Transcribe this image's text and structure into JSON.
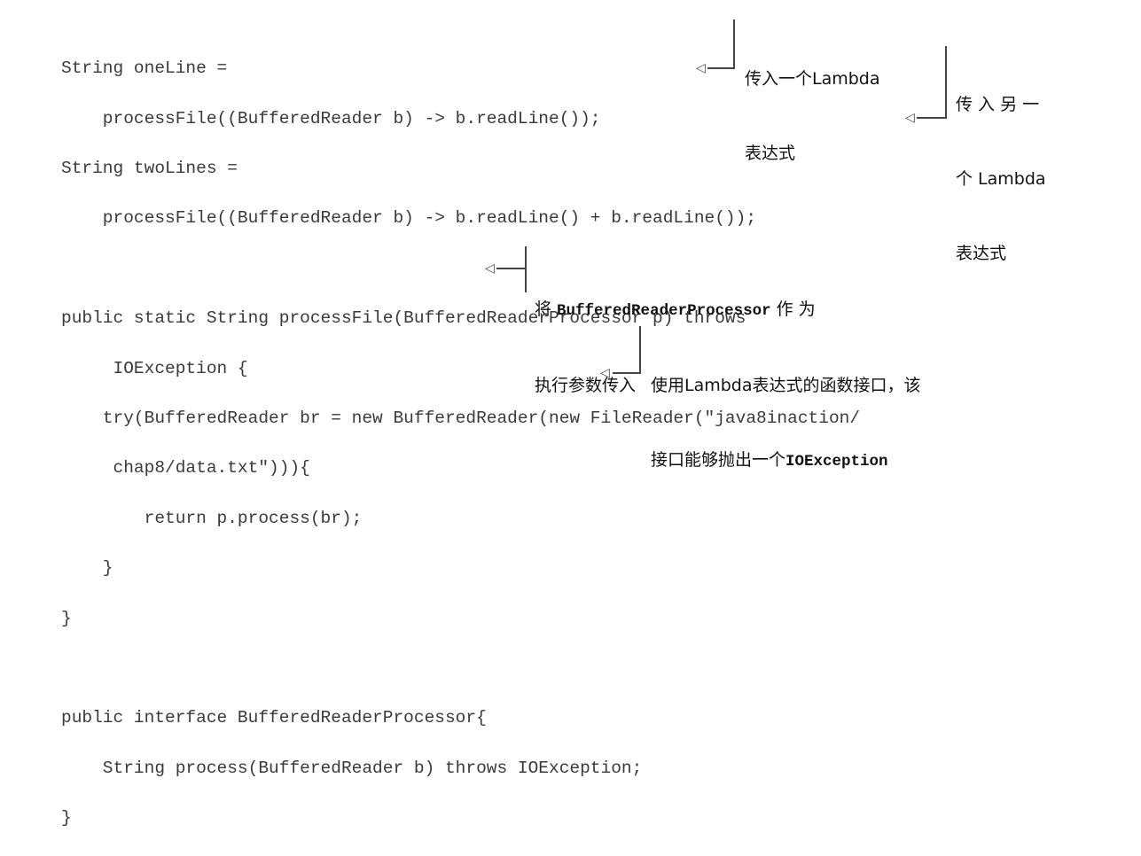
{
  "code": {
    "line1": "String oneLine =",
    "line2": "    processFile((BufferedReader b) -> b.readLine());",
    "line3": "String twoLines =",
    "line4": "    processFile((BufferedReader b) -> b.readLine() + b.readLine());",
    "line5": "",
    "line6": "public static String processFile(BufferedReaderProcessor p) throws",
    "line7": "     IOException {",
    "line8": "    try(BufferedReader br = new BufferedReader(new FileReader(\"java8inaction/",
    "line9": "     chap8/data.txt\"))){",
    "line10": "        return p.process(br);",
    "line11": "    }",
    "line12": "}",
    "line13": "",
    "line14": "public interface BufferedReaderProcessor{",
    "line15": "    String process(BufferedReader b) throws IOException;",
    "line16": "}"
  },
  "annotations": {
    "a1": {
      "line1": "传入一个Lambda",
      "line2": "表达式"
    },
    "a2": {
      "line1": "传 入 另 一",
      "line2": "个 Lambda",
      "line3": "表达式"
    },
    "a3": {
      "prefix": "将 ",
      "code": "BufferedReaderProcessor",
      "suffix": " 作 为",
      "line2": "执行参数传入"
    },
    "a4": {
      "line1": "使用Lambda表达式的函数接口，该",
      "line2_prefix": "接口能够抛出一个",
      "line2_code": "IOException"
    }
  },
  "colors": {
    "code_text": "#3a3a3a",
    "annotation_text": "#111111",
    "arrow": "#444444"
  }
}
